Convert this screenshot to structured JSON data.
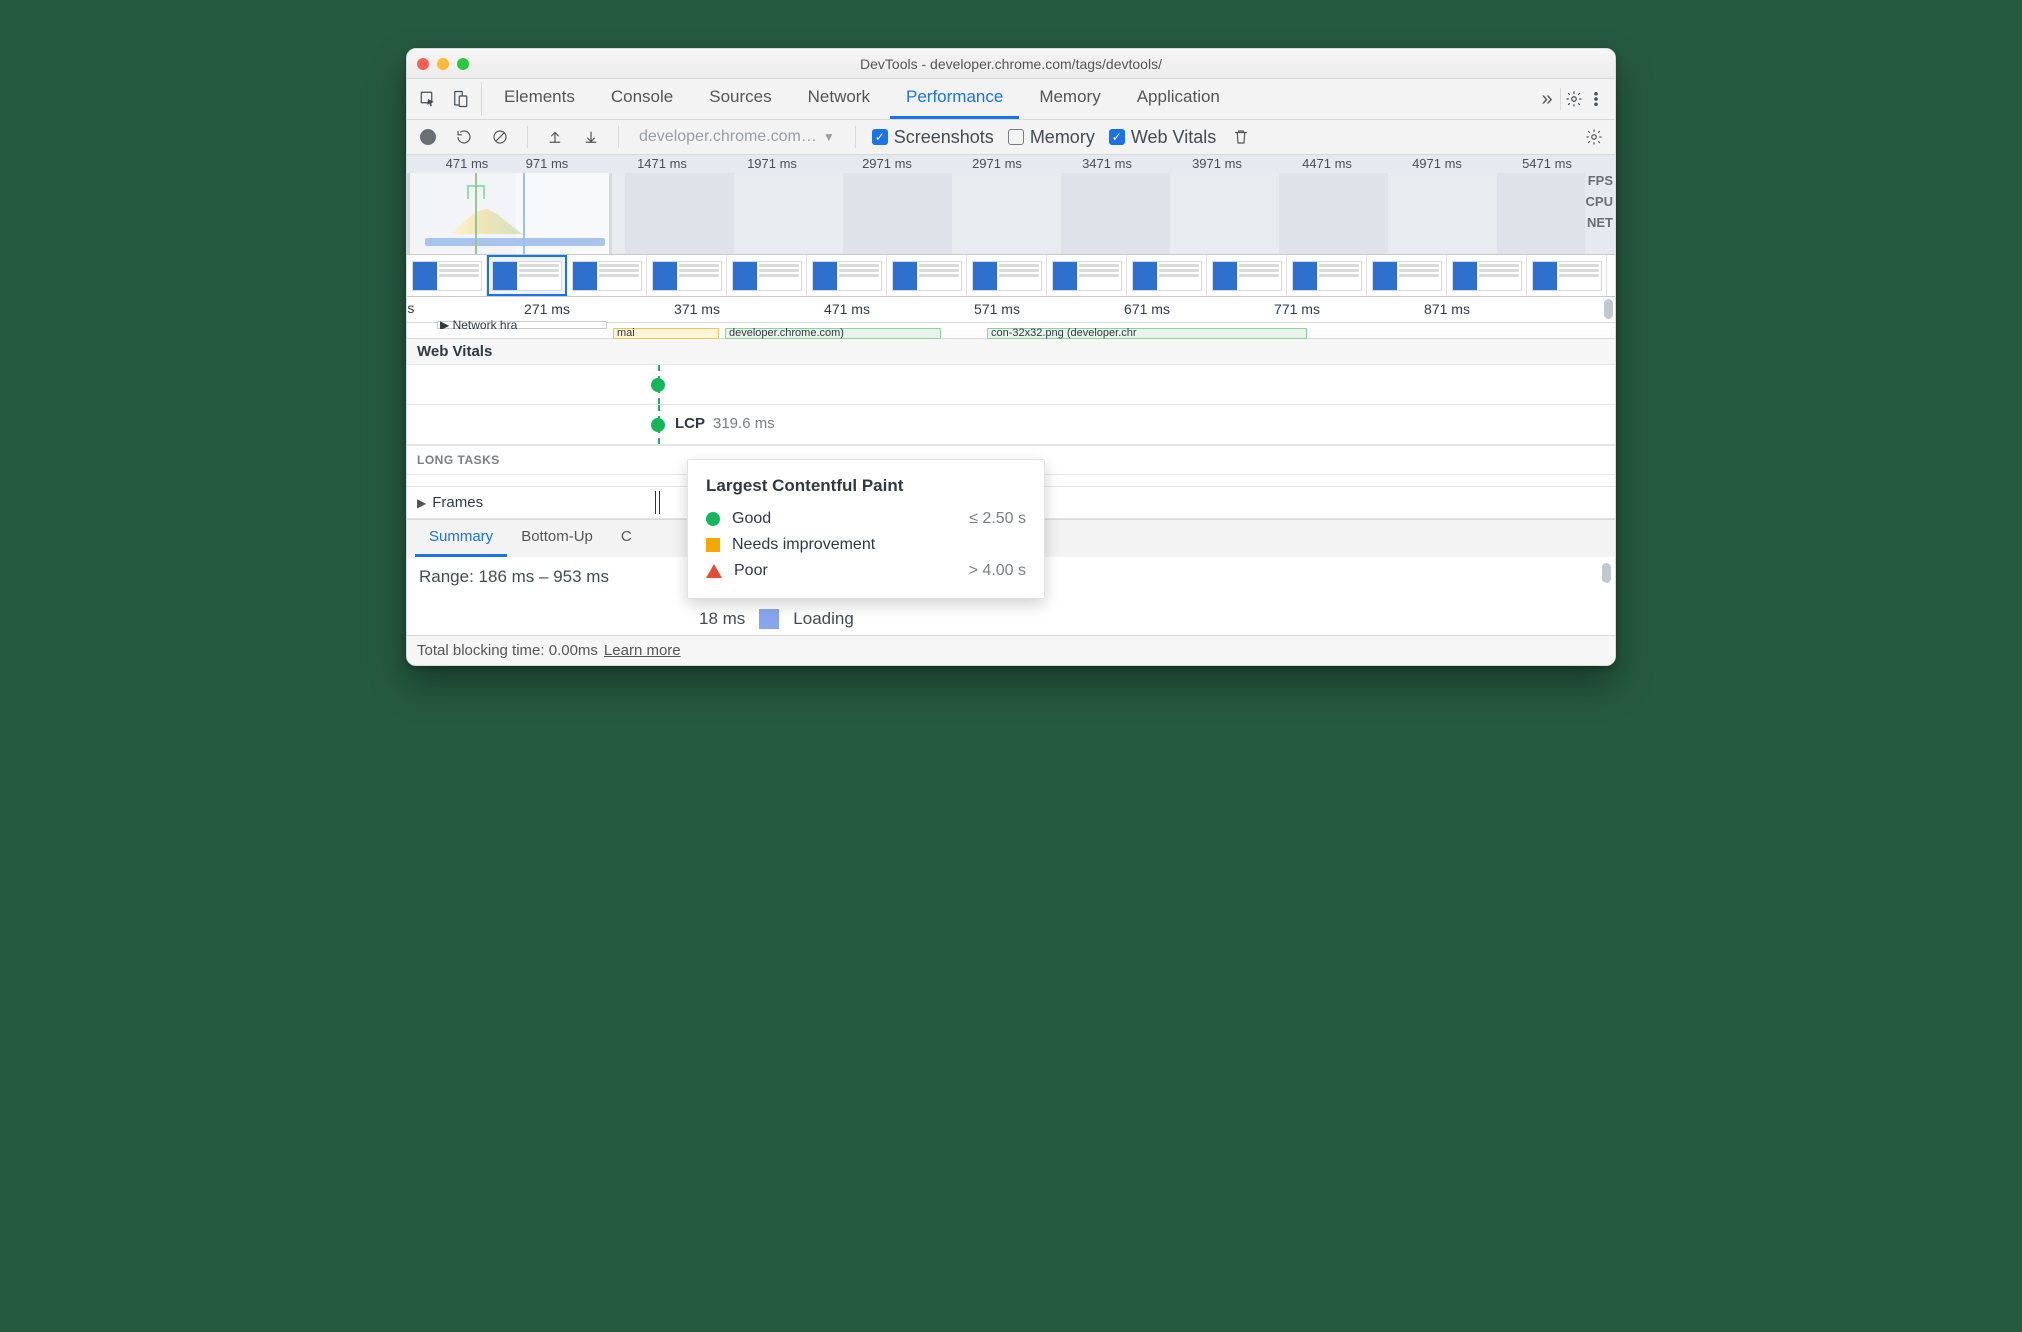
{
  "window": {
    "title": "DevTools - developer.chrome.com/tags/devtools/"
  },
  "tabs": {
    "items": [
      "Elements",
      "Console",
      "Sources",
      "Network",
      "Performance",
      "Memory",
      "Application"
    ],
    "active": 4
  },
  "toolbar": {
    "session": "developer.chrome.com…",
    "screenshots": {
      "label": "Screenshots",
      "checked": true
    },
    "memory": {
      "label": "Memory",
      "checked": false
    },
    "webvitals": {
      "label": "Web Vitals",
      "checked": true
    }
  },
  "overview": {
    "ticks": [
      "471 ms",
      "971 ms",
      "1471 ms",
      "1971 ms",
      "2971 ms",
      "2971 ms",
      "3471 ms",
      "3971 ms",
      "4471 ms",
      "4971 ms",
      "5471 ms"
    ],
    "labels": [
      "FPS",
      "CPU",
      "NET"
    ]
  },
  "detail": {
    "left_cut": "ns",
    "ticks": [
      "271 ms",
      "371 ms",
      "471 ms",
      "571 ms",
      "671 ms",
      "771 ms",
      "871 ms"
    ]
  },
  "flame": {
    "net_hint": "Network hra",
    "strip_b": "mai",
    "strip_c": "developer.chrome.com)",
    "strip_d": "con-32x32.png (developer.chr"
  },
  "sections": {
    "webvitals": "Web Vitals",
    "longtasks": "LONG TASKS",
    "frames": "Frames"
  },
  "lcp": {
    "name": "LCP",
    "value": "319.6 ms"
  },
  "tooltip": {
    "title": "Largest Contentful Paint",
    "rows": [
      {
        "shape": "circle",
        "label": "Good",
        "value": "≤ 2.50 s"
      },
      {
        "shape": "square",
        "label": "Needs improvement",
        "value": ""
      },
      {
        "shape": "triangle",
        "label": "Poor",
        "value": "> 4.00 s"
      }
    ]
  },
  "bottom_tabs": {
    "items": [
      "Summary",
      "Bottom-Up",
      "C"
    ],
    "active": 0
  },
  "summary": {
    "range_label": "Range: 186 ms – 953 ms",
    "loading_time": "18 ms",
    "loading_label": "Loading"
  },
  "footer": {
    "blocking": "Total blocking time: 0.00ms",
    "learn": "Learn more"
  }
}
